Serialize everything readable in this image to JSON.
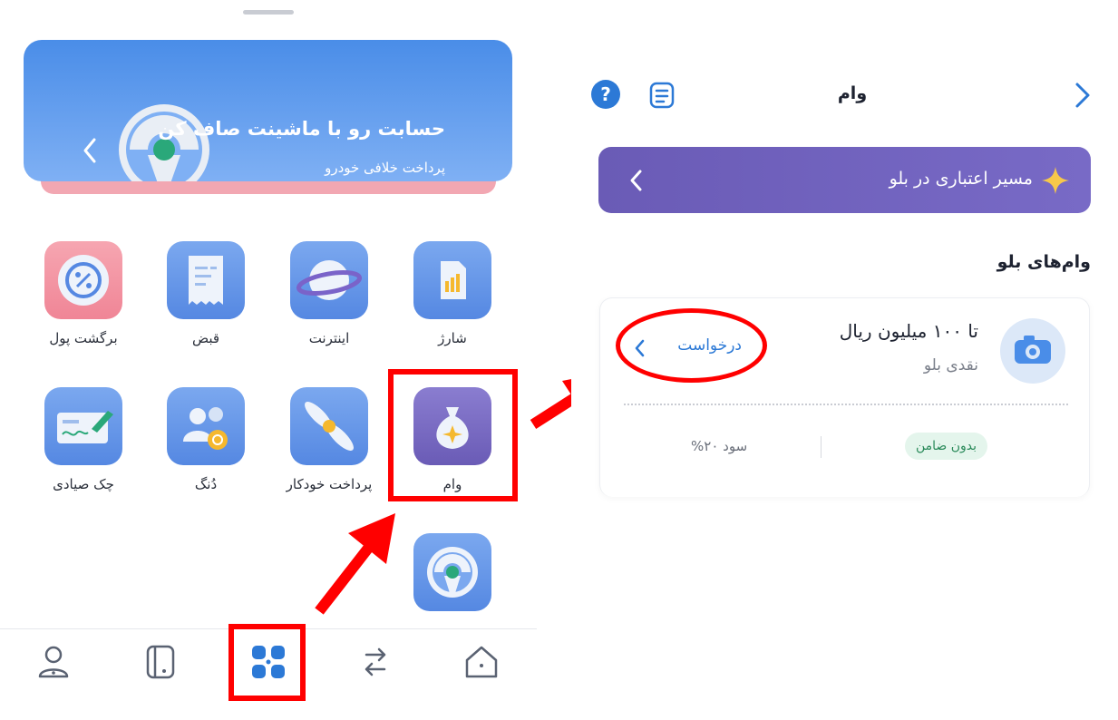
{
  "left": {
    "banner": {
      "title": "حسابت رو با ماشینت صاف کن",
      "subtitle": "پرداخت خلافی خودرو"
    },
    "services": [
      {
        "label": "شارژ",
        "icon": "sim-card-icon"
      },
      {
        "label": "اینترنت",
        "icon": "planet-icon"
      },
      {
        "label": "قبض",
        "icon": "receipt-icon"
      },
      {
        "label": "برگشت پول",
        "icon": "cashback-icon"
      },
      {
        "label": "وام",
        "icon": "money-bag-icon"
      },
      {
        "label": "پرداخت خودکار",
        "icon": "propeller-icon"
      },
      {
        "label": "دُنگ",
        "icon": "group-split-icon"
      },
      {
        "label": "چک صیادی",
        "icon": "cheque-icon"
      },
      {
        "label": "",
        "icon": "steering-wheel-icon"
      }
    ],
    "bottom_nav": [
      {
        "name": "home",
        "icon": "home-icon"
      },
      {
        "name": "transfer",
        "icon": "transfer-icon"
      },
      {
        "name": "services",
        "icon": "grid-icon",
        "active": true
      },
      {
        "name": "cards",
        "icon": "card-icon"
      },
      {
        "name": "profile",
        "icon": "profile-icon"
      }
    ]
  },
  "right": {
    "header": {
      "title": "وام"
    },
    "credit_banner": {
      "text": "مسیر اعتباری در بلو"
    },
    "section_title": "وام‌های بلو",
    "loan_card": {
      "title": "تا ۱۰۰ میلیون ریال",
      "subtitle": "نقدی بلو",
      "request_label": "درخواست",
      "badge": "بدون ضامن",
      "interest": "سود ۲۰%"
    }
  },
  "colors": {
    "accent_blue": "#2c79d6",
    "highlight_red": "#ff0000",
    "credit_purple": "#6a5bb6",
    "badge_green_bg": "#e4f5ec"
  }
}
